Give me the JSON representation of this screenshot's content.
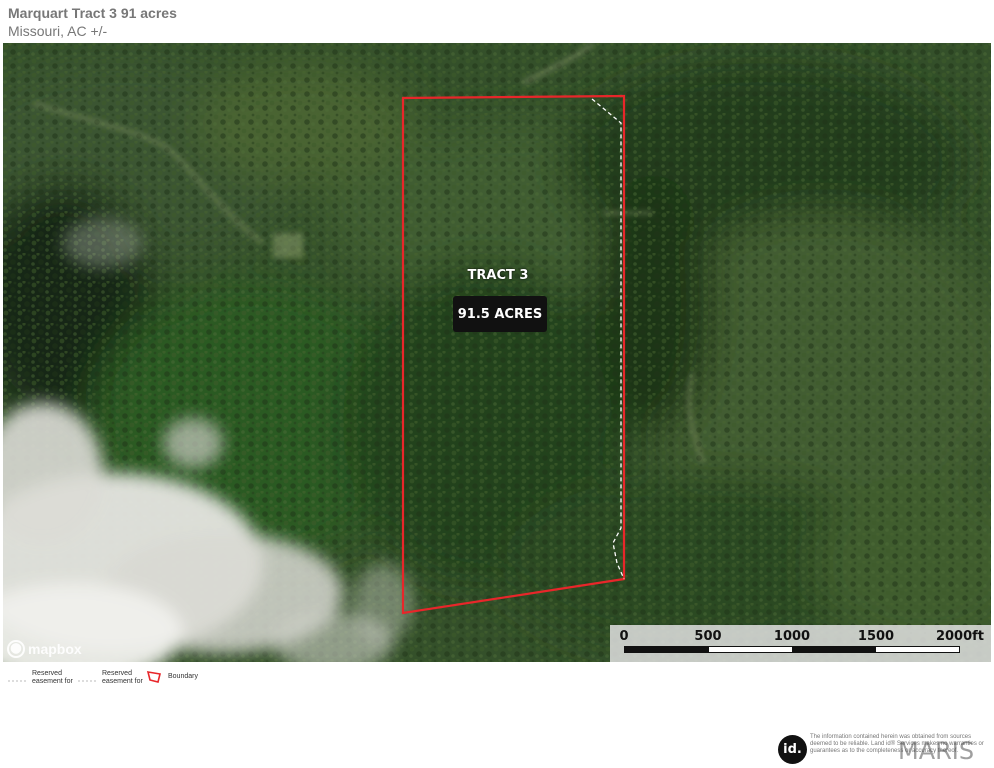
{
  "header": {
    "title": "Marquart Tract 3 91 acres",
    "subtitle": "Missouri,  AC +/-"
  },
  "map": {
    "attribution": "mapbox",
    "tract_label": "TRACT 3",
    "acres_label": "91.5 ACRES",
    "boundary_color": "#e8262a",
    "easement_color": "#ffffff",
    "scale_bar": {
      "labels": [
        "0",
        "500",
        "1000",
        "1500",
        "2000ft"
      ]
    }
  },
  "legend": {
    "items": [
      {
        "label": "Reserved easement for",
        "icon": "dashed-line-icon"
      },
      {
        "label": "Reserved easement for",
        "icon": "dashed-line-icon"
      },
      {
        "label": "Boundary",
        "icon": "boundary-polygon-icon"
      }
    ]
  },
  "footer": {
    "logo_text": "id.",
    "disclaimer": "The information contained herein was obtained from sources deemed to be reliable. Land id® Services makes no warranties or guarantees as to the completeness or accuracy thereof.",
    "watermark": "MARIS"
  }
}
